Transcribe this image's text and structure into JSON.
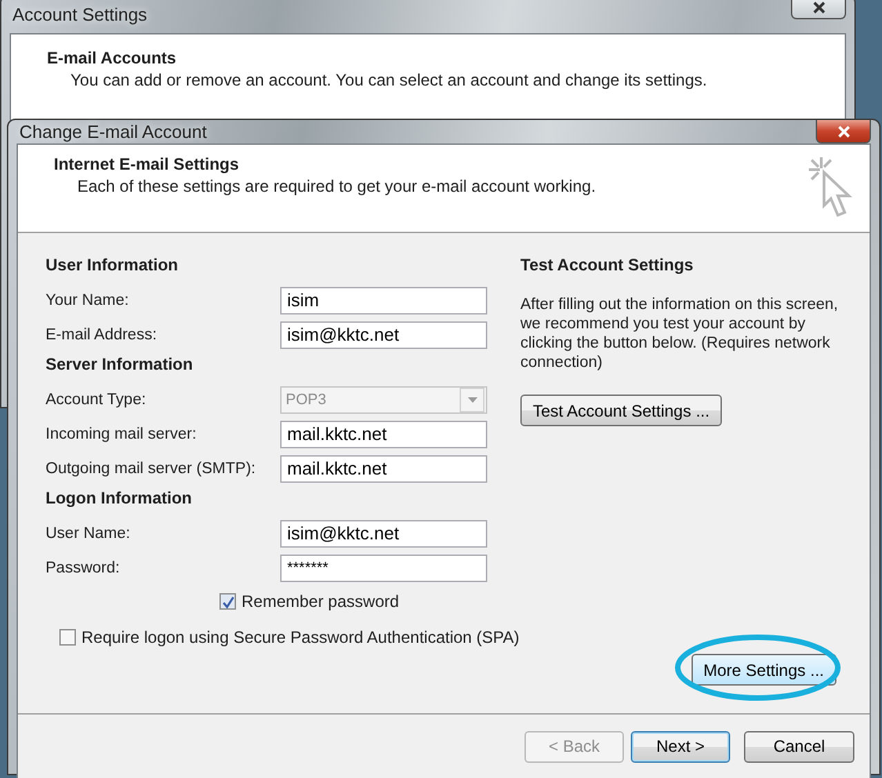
{
  "background_window": {
    "title": "Account Settings",
    "heading": "E-mail Accounts",
    "description": "You can add or remove an account. You can select an account and change its settings."
  },
  "dialog": {
    "title": "Change E-mail Account",
    "header": {
      "title": "Internet E-mail Settings",
      "description": "Each of these settings are required to get your e-mail account working."
    },
    "sections": [
      {
        "heading": "User Information",
        "fields": [
          {
            "label": "Your Name:",
            "value": "isim",
            "kind": "text",
            "disabled": false
          },
          {
            "label": "E-mail Address:",
            "value": "isim@kktc.net",
            "kind": "text",
            "disabled": false
          }
        ]
      },
      {
        "heading": "Server Information",
        "fields": [
          {
            "label": "Account Type:",
            "value": "POP3",
            "kind": "dropdown",
            "disabled": true
          },
          {
            "label": "Incoming mail server:",
            "value": "mail.kktc.net",
            "kind": "text",
            "disabled": false
          },
          {
            "label": "Outgoing mail server (SMTP):",
            "value": "mail.kktc.net",
            "kind": "text",
            "disabled": false
          }
        ]
      },
      {
        "heading": "Logon Information",
        "fields": [
          {
            "label": "User Name:",
            "value": "isim@kktc.net",
            "kind": "text",
            "disabled": false
          },
          {
            "label": "Password:",
            "value": "*******",
            "kind": "password",
            "disabled": false
          }
        ]
      }
    ],
    "remember_password": {
      "label": "Remember password",
      "checked": true
    },
    "spa": {
      "label": "Require logon using Secure Password Authentication (SPA)",
      "checked": false
    },
    "test": {
      "heading": "Test Account Settings",
      "description": "After filling out the information on this screen, we recommend you test your account by clicking the button below. (Requires network connection)",
      "button": "Test Account Settings ..."
    },
    "more_settings": {
      "label": "More Settings ...",
      "highlighted": true
    },
    "buttons": [
      {
        "label": "< Back",
        "disabled": true,
        "default": false
      },
      {
        "label": "Next >",
        "disabled": false,
        "default": true
      },
      {
        "label": "Cancel",
        "disabled": false,
        "default": false
      }
    ]
  }
}
